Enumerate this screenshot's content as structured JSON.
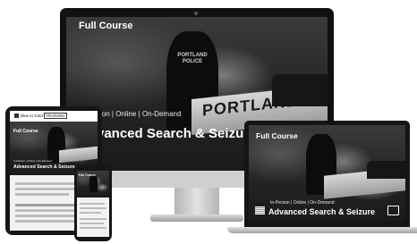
{
  "desktop": {
    "label": "Full Course",
    "subtitle": "In-Person | Online | On-Demand",
    "headline": "Advanced Search & Seizure",
    "badge_line1": "PORTLAND",
    "badge_line2": "POLICE",
    "car_text": "PORTLAND P"
  },
  "tablet": {
    "logo_text": "Blue to Gold",
    "logo_suffix": "TRAINING",
    "label": "Full Course",
    "subtitle": "In-Person | Online | On-Demand",
    "headline": "Advanced Search & Seizure"
  },
  "laptop": {
    "label": "Full Course",
    "subtitle": "In-Person | Online | On-Demand",
    "headline": "Advanced Search & Seizure"
  },
  "phone": {
    "label": "Full Course"
  },
  "icons": [
    "camera-icon",
    "flag-icon",
    "book-icon"
  ]
}
